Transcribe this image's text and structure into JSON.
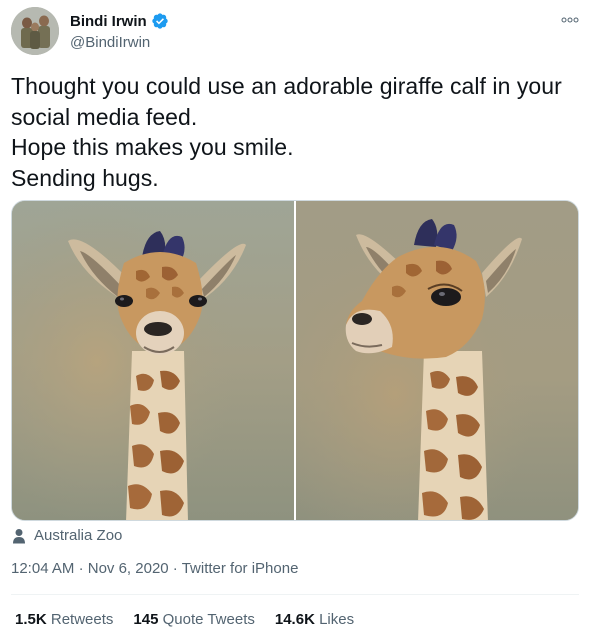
{
  "author": {
    "name": "Bindi Irwin",
    "handle": "@BindiIrwin",
    "verified_color": "#1d9bf0"
  },
  "tweet": {
    "lines": [
      "Thought you could use an adorable giraffe calf in your",
      "social media feed.",
      "Hope this makes you smile.",
      "Sending hugs."
    ]
  },
  "location": "Australia Zoo",
  "meta": {
    "time": "12:04 AM",
    "separator": "·",
    "date": "Nov 6, 2020",
    "source": "Twitter for iPhone"
  },
  "stats": {
    "retweets_count": "1.5K",
    "retweets_label": "Retweets",
    "quotes_count": "145",
    "quotes_label": "Quote Tweets",
    "likes_count": "14.6K",
    "likes_label": "Likes"
  },
  "icons": {
    "verified": "verified-badge-icon",
    "more": "more-options-icon",
    "location": "person-icon"
  }
}
